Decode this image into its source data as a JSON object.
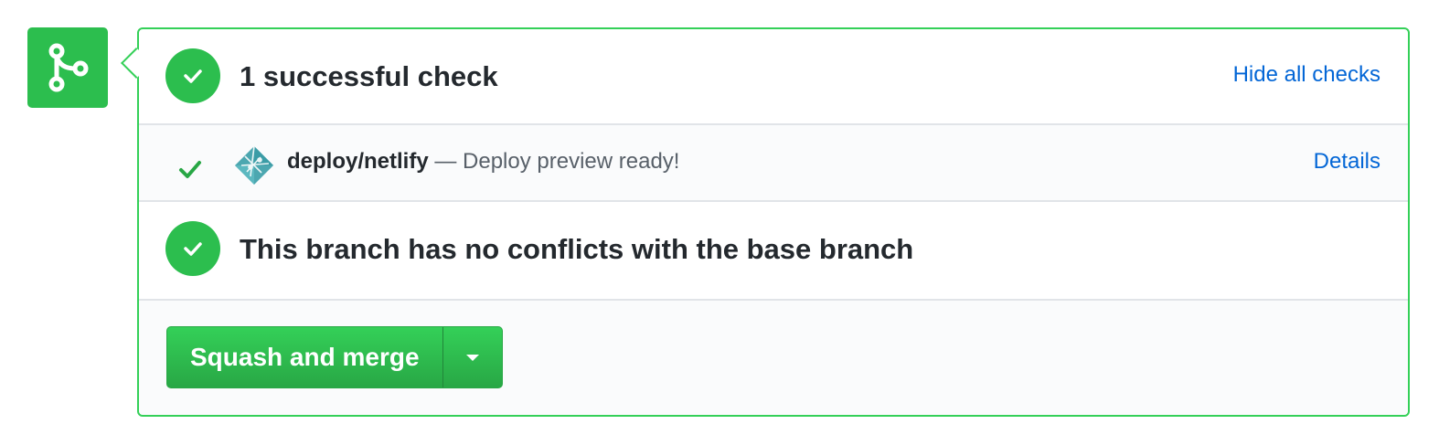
{
  "checks": {
    "summary": "1 successful check",
    "hide_link": "Hide all checks"
  },
  "netlify": {
    "name": "deploy/netlify",
    "description": " — Deploy preview ready!",
    "details_link": "Details"
  },
  "conflicts": {
    "message": "This branch has no conflicts with the base branch"
  },
  "merge": {
    "button_label": "Squash and merge"
  },
  "icons": {
    "merge_status": "git-merge-icon",
    "check": "check-icon",
    "netlify": "netlify-logo-icon",
    "dropdown": "caret-down-icon"
  },
  "colors": {
    "success_green": "#2cbe4e",
    "border_green": "#34d058",
    "link_blue": "#0366d6"
  }
}
